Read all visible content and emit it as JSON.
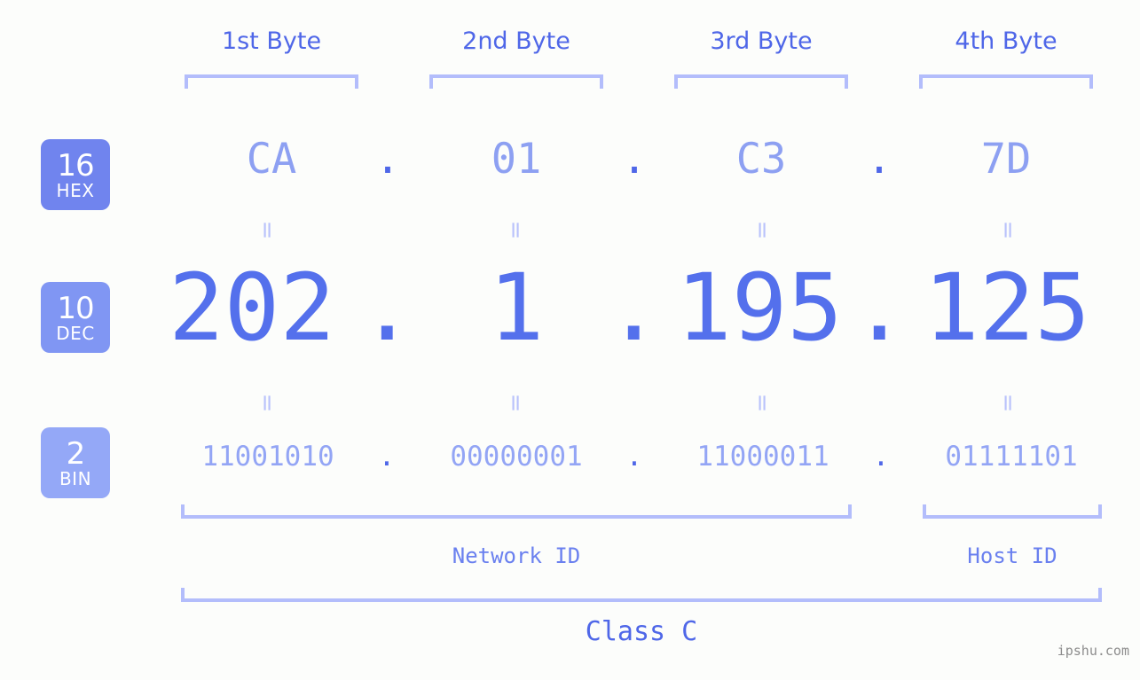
{
  "page": {
    "background": "#fcfdfb",
    "accent_strong": "#4f67e8",
    "accent_mid": "#8096f3",
    "accent_light": "#b3bdfb",
    "watermark": "ipshu.com"
  },
  "header": {
    "byte_labels": [
      {
        "label": "1st Byte"
      },
      {
        "label": "2nd Byte"
      },
      {
        "label": "3rd Byte"
      },
      {
        "label": "4th Byte"
      }
    ]
  },
  "bases": [
    {
      "number": "16",
      "name": "HEX",
      "color": "#7084ee"
    },
    {
      "number": "10",
      "name": "DEC",
      "color": "#8096f3"
    },
    {
      "number": "2",
      "name": "BIN",
      "color": "#94a8f7"
    }
  ],
  "rows": {
    "hex": {
      "base_number": "16",
      "base_name": "HEX",
      "values": [
        "CA",
        "01",
        "C3",
        "7D"
      ],
      "separator": "."
    },
    "dec": {
      "base_number": "10",
      "base_name": "DEC",
      "values": [
        "202",
        "1",
        "195",
        "125"
      ],
      "separator": "."
    },
    "bin": {
      "base_number": "2",
      "base_name": "BIN",
      "values": [
        "11001010",
        "00000001",
        "11000011",
        "01111101"
      ],
      "separator": "."
    }
  },
  "equals": {
    "glyph": "="
  },
  "footer": {
    "network_id_label": "Network ID",
    "host_id_label": "Host ID",
    "class_label": "Class C"
  },
  "ip_address": {
    "hex": "CA.01.C3.7D",
    "dec": "202.1.195.125",
    "bin": "11001010.00000001.11000011.01111101"
  }
}
